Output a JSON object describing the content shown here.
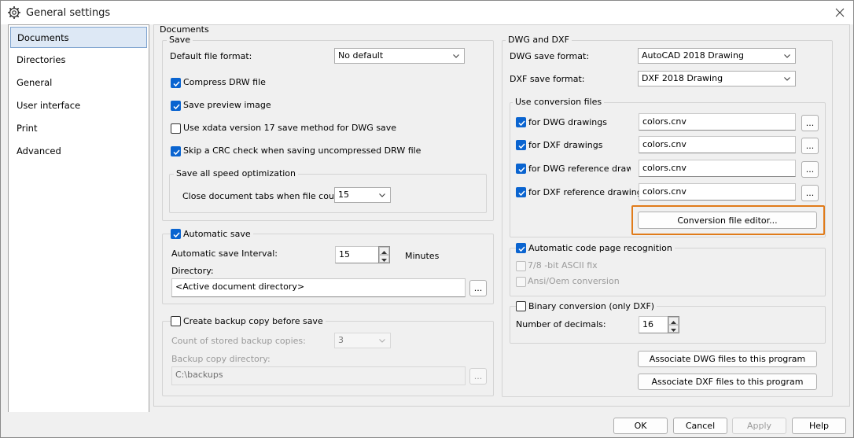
{
  "window": {
    "title": "General settings"
  },
  "nav": {
    "items": [
      "Documents",
      "Directories",
      "General",
      "User interface",
      "Print",
      "Advanced"
    ],
    "selected": "Documents"
  },
  "documents": {
    "group_title": "Documents",
    "save": {
      "title": "Save",
      "default_format_label": "Default file format:",
      "default_format_value": "No default",
      "compress_label": "Compress DRW file",
      "compress_checked": true,
      "preview_label": "Save preview image",
      "preview_checked": true,
      "xdata_label": "Use xdata version 17 save method for DWG save",
      "xdata_checked": false,
      "crc_label": "Skip a CRC check when saving uncompressed DRW file",
      "crc_checked": true,
      "speed": {
        "title": "Save all speed optimization",
        "close_tabs_label": "Close document tabs when file count >",
        "close_tabs_value": "15"
      }
    },
    "autosave": {
      "title": "Automatic save",
      "checked": true,
      "interval_label": "Automatic save Interval:",
      "interval_value": "15",
      "interval_unit": "Minutes",
      "directory_label": "Directory:",
      "directory_value": "<Active document directory>",
      "browse_label": "..."
    },
    "backup": {
      "title": "Create backup copy before save",
      "checked": false,
      "count_label": "Count of stored backup copies:",
      "count_value": "3",
      "dir_label": "Backup copy directory:",
      "dir_value": "C:\\backups",
      "browse_label": "..."
    }
  },
  "dwg_dxf": {
    "title": "DWG and DXF",
    "dwg_format_label": "DWG save format:",
    "dwg_format_value": "AutoCAD 2018 Drawing",
    "dxf_format_label": "DXF save format:",
    "dxf_format_value": "DXF 2018 Drawing",
    "conversion": {
      "title": "Use conversion files",
      "rows": [
        {
          "label": "for DWG drawings",
          "checked": true,
          "file": "colors.cnv",
          "browse": "..."
        },
        {
          "label": "for DXF drawings",
          "checked": true,
          "file": "colors.cnv",
          "browse": "..."
        },
        {
          "label": "for DWG reference drawings",
          "checked": true,
          "file": "colors.cnv",
          "browse": "..."
        },
        {
          "label": "for DXF reference drawings",
          "checked": true,
          "file": "colors.cnv",
          "browse": "..."
        }
      ],
      "editor_button": "Conversion file editor...",
      "highlight_color": "#e07b1a"
    },
    "codepage": {
      "title": "Automatic code page recognition",
      "checked": true,
      "ascii_label": "7/8 -bit ASCII fix",
      "ansi_label": "Ansi/Oem conversion"
    },
    "binary": {
      "title": "Binary conversion (only DXF)",
      "checked": false,
      "decimals_label": "Number of decimals:",
      "decimals_value": "16"
    },
    "assoc_dwg_button": "Associate DWG files to this program",
    "assoc_dxf_button": "Associate DXF files to this program"
  },
  "footer": {
    "ok": "OK",
    "cancel": "Cancel",
    "apply": "Apply",
    "help": "Help"
  },
  "colors": {
    "accent": "#0a64d0",
    "selection": "#dde8f5",
    "highlight": "#e07b1a"
  }
}
